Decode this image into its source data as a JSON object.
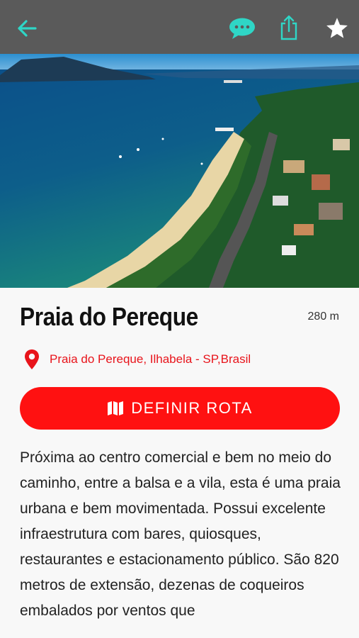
{
  "header": {
    "back_icon": "arrow-left-icon",
    "chat_icon": "chat-bubble-icon",
    "share_icon": "share-icon",
    "favorite_icon": "star-icon",
    "accent_color": "#2fd6c6"
  },
  "place": {
    "name": "Praia do Pereque",
    "distance": "280 m",
    "location": "Praia do Pereque, Ilhabela - SP,Brasil",
    "route_button_label": "DEFINIR ROTA",
    "description": "Próxima ao centro comercial e bem no meio do caminho, entre a balsa e a vila, esta é uma praia urbana e bem movimentada. Possui excelente infraestrutura com bares, quiosques, restaurantes e estacionamento público. São 820 metros de extensão, dezenas de coqueiros embalados por ventos que"
  },
  "colors": {
    "primary_red": "#ff1111",
    "topbar": "#5a5a5a"
  }
}
